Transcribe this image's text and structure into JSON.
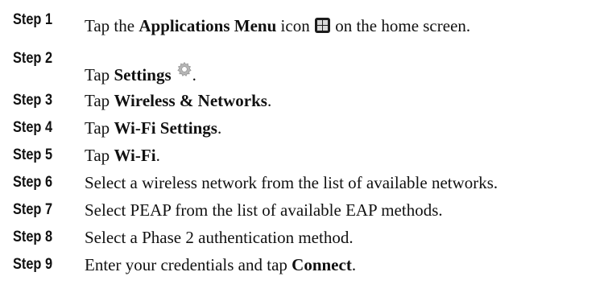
{
  "steps": [
    {
      "label": "Step 1",
      "pre": "Tap the ",
      "bold": "Applications Menu",
      "post": " icon",
      "post2": " on the home screen."
    },
    {
      "label": "Step 2",
      "pre": "Tap ",
      "bold": "Settings",
      "post": ".",
      "post2": ""
    },
    {
      "label": "Step 3",
      "pre": "Tap ",
      "bold": "Wireless & Networks",
      "post": ".",
      "post2": ""
    },
    {
      "label": "Step 4",
      "pre": "Tap ",
      "bold": "Wi-Fi Settings",
      "post": ".",
      "post2": ""
    },
    {
      "label": "Step 5",
      "pre": "Tap ",
      "bold": "Wi-Fi",
      "post": ".",
      "post2": ""
    },
    {
      "label": "Step 6",
      "pre": "Select a wireless network from the list of available networks.",
      "bold": "",
      "post": "",
      "post2": ""
    },
    {
      "label": "Step 7",
      "pre": "Select PEAP from the list of available EAP methods.",
      "bold": "",
      "post": "",
      "post2": ""
    },
    {
      "label": "Step 8",
      "pre": "Select a Phase 2 authentication method.",
      "bold": "",
      "post": "",
      "post2": ""
    },
    {
      "label": "Step 9",
      "pre": "Enter your credentials and tap ",
      "bold": "Connect",
      "post": ".",
      "post2": ""
    }
  ]
}
